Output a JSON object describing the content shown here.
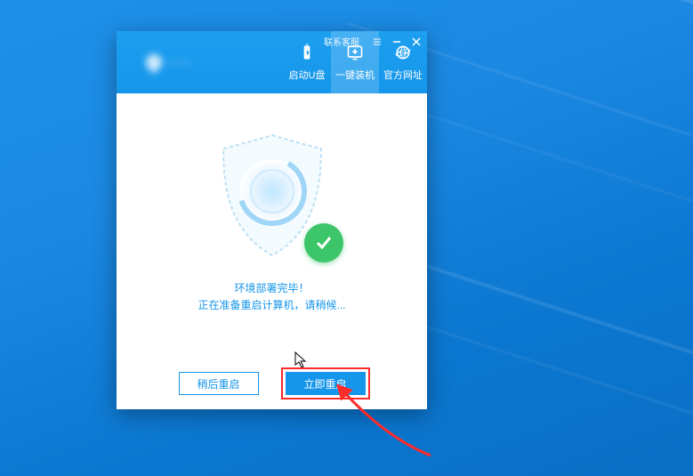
{
  "window": {
    "contact_label": "联系客服",
    "tabs": [
      {
        "label": "启动U盘"
      },
      {
        "label": "一键装机"
      },
      {
        "label": "官方网址"
      }
    ],
    "active_tab_index": 1
  },
  "status": {
    "line1": "环境部署完毕！",
    "line2": "正在准备重启计算机，请稍候..."
  },
  "buttons": {
    "later": "稍后重启",
    "now": "立即重启"
  },
  "colors": {
    "accent": "#1596ea",
    "success": "#3cc569",
    "highlight": "#ff2a2a"
  }
}
